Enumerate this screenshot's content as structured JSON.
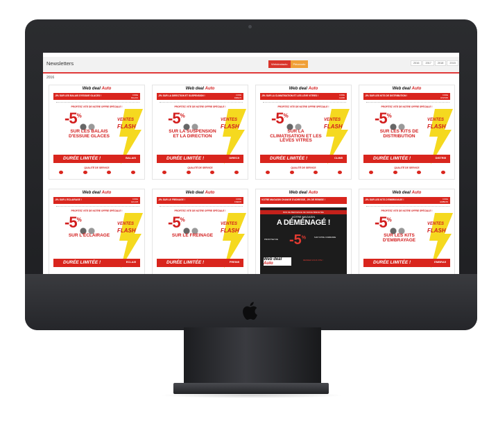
{
  "app": {
    "title": "Newsletters",
    "tabs": [
      {
        "label": "Webdealauto"
      },
      {
        "label": "Pièceauto"
      }
    ],
    "years": [
      "2016",
      "2017",
      "2018",
      "2015"
    ],
    "section_year": "2016"
  },
  "newsletters": [
    {
      "banner": "-5% SUR LES BALAIS D'ESSUIE GLACES !",
      "code_label": "CODE",
      "code": "BALAIS",
      "offer": "PROFITEZ VITE DE NOTRE OFFRE SPÉCIALE !",
      "percent": "-5",
      "headline": "SUR LES BALAIS D'ESSUIE GLACES",
      "flash1": "VENTES",
      "flash2": "FLASH",
      "limitee": "DURÉE LIMITÉE !",
      "qualite": "QUALITÉ DE SERVICE"
    },
    {
      "banner": "-5% SUR LA DIRECTION ET SUSPENSION !",
      "code_label": "CODE",
      "code": "DIREC5",
      "offer": "PROFITEZ VITE DE NOTRE OFFRE SPÉCIALE !",
      "percent": "-5",
      "headline": "SUR LA SUSPENSION ET LA DIRECTION",
      "flash1": "VENTES",
      "flash2": "FLASH",
      "limitee": "DURÉE LIMITÉE !",
      "qualite": "QUALITÉ DE SERVICE"
    },
    {
      "banner": "-5% SUR LA CLIMATISATION ET LES LÈVE VITRES !",
      "code_label": "CODE",
      "code": "CLIM5",
      "offer": "PROFITEZ VITE DE NOTRE OFFRE SPÉCIALE !",
      "percent": "-5",
      "headline": "SUR LA CLIMATISATION ET LES LÈVES VITRES",
      "flash1": "VENTES",
      "flash2": "FLASH",
      "limitee": "DURÉE LIMITÉE !",
      "qualite": "QUALITÉ DE SERVICE"
    },
    {
      "banner": "-5% SUR LES KITS DE DISTRIBUTION !",
      "code_label": "CODE",
      "code": "DISTRI5",
      "offer": "PROFITEZ VITE DE NOTRE OFFRE SPÉCIALE !",
      "percent": "-5",
      "headline": "SUR LES KITS DE DISTRIBUTION",
      "flash1": "VENTES",
      "flash2": "FLASH",
      "limitee": "DURÉE LIMITÉE !",
      "qualite": "QUALITÉ DE SERVICE"
    },
    {
      "banner": "-5% SUR L'ÉCLAIRAGE !",
      "code_label": "CODE",
      "code": "ECLAI5",
      "offer": "PROFITEZ VITE DE NOTRE OFFRE SPÉCIALE !",
      "percent": "-5",
      "headline": "SUR L'ÉCLAIRAGE",
      "flash1": "VENTES",
      "flash2": "FLASH",
      "limitee": "DURÉE LIMITÉE !",
      "qualite": ""
    },
    {
      "banner": "-5% SUR LE FREINAGE !",
      "code_label": "CODE",
      "code": "FREIN5",
      "offer": "PROFITEZ VITE DE NOTRE OFFRE SPÉCIALE !",
      "percent": "-5",
      "headline": "SUR LE FREINAGE",
      "flash1": "VENTES",
      "flash2": "FLASH",
      "limitee": "DURÉE LIMITÉE !",
      "qualite": ""
    },
    {
      "banner": "VOTRE MAGASIN CHANGE D'ADRESSE, -5% DE REMISE !",
      "dark_top": "BON DE BIENVENUE DE VENUE BREVETÉE",
      "dark_h1": "VOTRE MAGASIN",
      "dark_h2": "A DÉMÉNAGÉ !",
      "dark_promo": "PROFITEZ DE",
      "percent": "-5",
      "dark_side": "SUR VOTRE COMMANDE",
      "dark_foot": "RENDEZ-VOUS VITE !",
      "logo_a": "Web deal",
      "logo_b": "Auto"
    },
    {
      "banner": "-5% SUR LES KITS D'EMBRAYAGE !",
      "code_label": "CODE",
      "code": "EMBRA5",
      "offer": "PROFITEZ VITE DE NOTRE OFFRE SPÉCIALE !",
      "percent": "-5",
      "headline": "SUR LES KITS D'EMBRAYAGE",
      "flash1": "VENTES",
      "flash2": "FLASH",
      "limitee": "DURÉE LIMITÉE !",
      "qualite": ""
    }
  ],
  "logo": {
    "part1": "Web deal",
    "part2": "Auto"
  },
  "colors": {
    "brand_red": "#d9251d",
    "accent_orange": "#f0a037",
    "bezel": "#25262a"
  }
}
